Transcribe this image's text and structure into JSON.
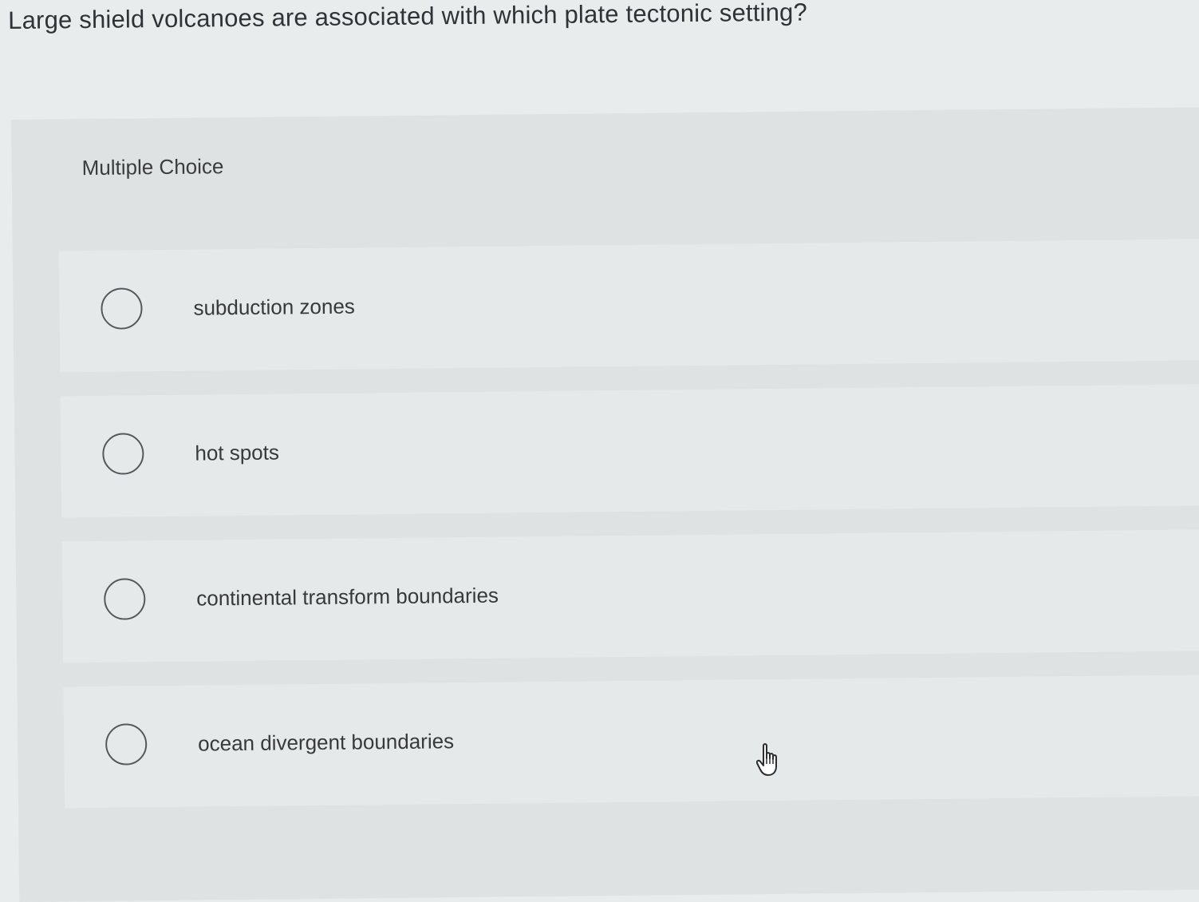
{
  "question": {
    "text": "Large shield volcanoes are associated with which plate tectonic setting?"
  },
  "panel": {
    "title": "Multiple Choice"
  },
  "choices": [
    {
      "label": "subduction zones",
      "selected": false
    },
    {
      "label": "hot spots",
      "selected": false
    },
    {
      "label": "continental transform boundaries",
      "selected": false
    },
    {
      "label": "ocean divergent boundaries",
      "selected": false
    }
  ],
  "cursor": {
    "icon": "hand-pointer-icon"
  }
}
